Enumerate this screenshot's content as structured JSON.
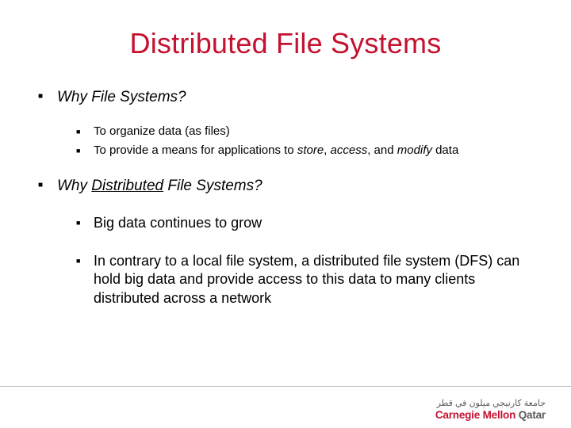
{
  "title": "Distributed File Systems",
  "sections": [
    {
      "heading": "Why File Systems?",
      "style": "small",
      "items": [
        {
          "plain": "To organize data (as files)"
        },
        {
          "pre": "To provide a means for applications to ",
          "em1": "store",
          "mid1": ", ",
          "em2": "access",
          "mid2": ", and ",
          "em3": "modify",
          "post": " data"
        }
      ]
    },
    {
      "heading_pre": "Why ",
      "heading_u": "Distributed",
      "heading_post": " File Systems?",
      "style": "big",
      "items": [
        {
          "pre": "Big data",
          "post": " continues to grow"
        },
        {
          "pre": "In contrary to a local file system, a ",
          "em1": "distributed file system ",
          "strong": "(DFS)",
          "post": " can hold big data and provide access to this data to many clients distributed across a network"
        }
      ]
    }
  ],
  "logo": {
    "arabic": "جامعة كارنيجي ميلون في قطر",
    "en_main": "Carnegie Mellon",
    "en_sub": "Qatar"
  }
}
